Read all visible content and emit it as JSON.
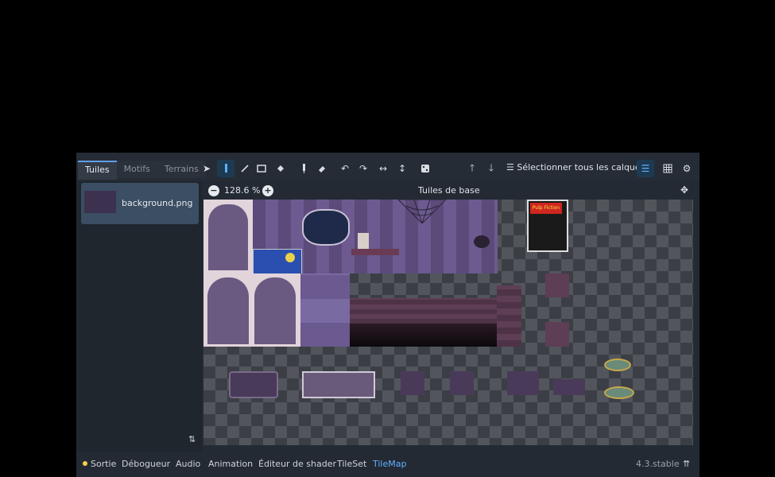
{
  "tabs": [
    {
      "label": "Tuiles",
      "active": true
    },
    {
      "label": "Motifs",
      "active": false
    },
    {
      "label": "Terrains",
      "active": false
    }
  ],
  "toolbar": {
    "tools": [
      "select-icon",
      "paint-icon",
      "line-icon",
      "rect-icon",
      "bucket-icon",
      "picker-icon",
      "eraser-icon",
      "rotate-left-icon",
      "rotate-right-icon",
      "flip-h-icon",
      "flip-v-icon",
      "random-icon"
    ],
    "active_tool": "paint-icon",
    "select_all_layers": "Sélectionner tous les calques"
  },
  "sources": [
    {
      "name": "background.png",
      "selected": true
    }
  ],
  "zoom": {
    "value": "128.6 %"
  },
  "atlas": {
    "title": "Tuiles de base",
    "poster_text": "Pulp Fiction"
  },
  "bottom_tabs": [
    {
      "label": "Sortie",
      "active": false,
      "status_dot": "#f2d24a"
    },
    {
      "label": "Débogueur",
      "active": false
    },
    {
      "label": "Audio",
      "active": false
    },
    {
      "label": "Animation",
      "active": false
    },
    {
      "label": "Éditeur de shader",
      "active": false
    },
    {
      "label": "TileSet",
      "active": false
    },
    {
      "label": "TileMap",
      "active": true
    }
  ],
  "version": "4.3.stable",
  "colors": {
    "accent": "#5fb0ff",
    "panel_bg": "#222a33",
    "wall_purple": "#5a4a78",
    "dark_wood": "#3e2a3e"
  }
}
